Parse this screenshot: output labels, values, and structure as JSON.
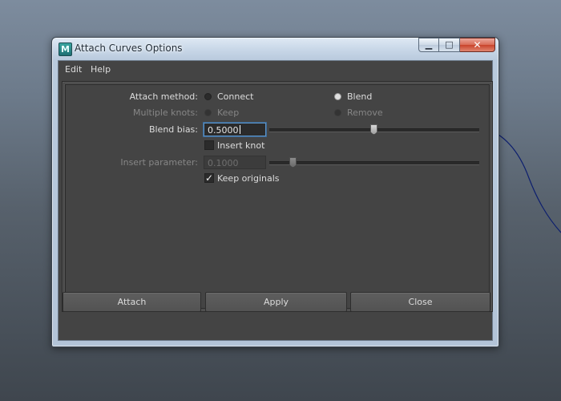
{
  "window": {
    "title": "Attach Curves Options",
    "app_icon_letter": "M",
    "caption": {
      "minimize_glyph": "▁",
      "maximize_glyph": "□",
      "close_glyph": "✕"
    }
  },
  "menu": {
    "items": [
      {
        "label": "Edit"
      },
      {
        "label": "Help"
      }
    ]
  },
  "options": {
    "attach_method": {
      "label": "Attach method:",
      "choices": [
        {
          "label": "Connect",
          "selected": false
        },
        {
          "label": "Blend",
          "selected": true
        }
      ]
    },
    "multiple_knots": {
      "label": "Multiple knots:",
      "enabled": false,
      "choices": [
        {
          "label": "Keep",
          "selected": true
        },
        {
          "label": "Remove",
          "selected": false
        }
      ]
    },
    "blend_bias": {
      "label": "Blend bias:",
      "value": "0.5000",
      "slider_fraction": 0.5
    },
    "insert_knot": {
      "label": "Insert knot",
      "checked": false
    },
    "insert_parameter": {
      "label": "Insert parameter:",
      "value": "0.1000",
      "enabled": false,
      "slider_fraction": 0.1
    },
    "keep_originals": {
      "label": "Keep originals",
      "checked": true,
      "check_glyph": "✓"
    }
  },
  "buttons": {
    "attach": "Attach",
    "apply": "Apply",
    "close": "Close"
  },
  "colors": {
    "panel": "#444444",
    "accent_focus": "#5d93c6",
    "viewport_curve": "#0d1f6e"
  }
}
